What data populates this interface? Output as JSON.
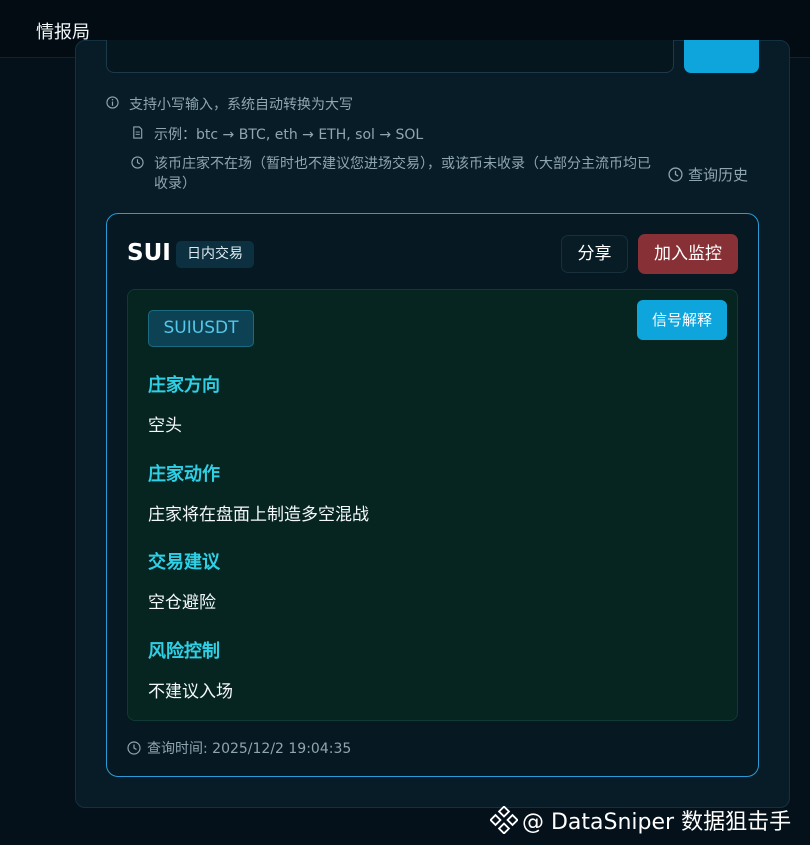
{
  "app": {
    "title": "情报局"
  },
  "hints": {
    "lowercase": "支持小写输入，系统自动转换为大写",
    "example": "示例：btc → BTC, eth → ETH, sol → SOL",
    "not_found": "该币庄家不在场（暂时也不建议您进场交易），或该币未收录（大部分主流币均已收录）",
    "history_link": "查询历史"
  },
  "result": {
    "symbol": "SUI",
    "trade_type": "日内交易",
    "share_label": "分享",
    "monitor_label": "加入监控",
    "pair": "SUIUSDT",
    "explain_label": "信号解释",
    "sections": [
      {
        "heading": "庄家方向",
        "value": "空头"
      },
      {
        "heading": "庄家动作",
        "value": "庄家将在盘面上制造多空混战"
      },
      {
        "heading": "交易建议",
        "value": "空仓避险"
      },
      {
        "heading": "风险控制",
        "value": "不建议入场"
      }
    ],
    "query_time": "查询时间: 2025/12/2 19:04:35"
  },
  "watermark": {
    "text": "@ DataSniper 数据狙击手"
  },
  "colors": {
    "accent": "#0ea5dc",
    "danger": "#873136",
    "section_heading": "#2fd0e6",
    "card_border": "#2a9bd6"
  }
}
